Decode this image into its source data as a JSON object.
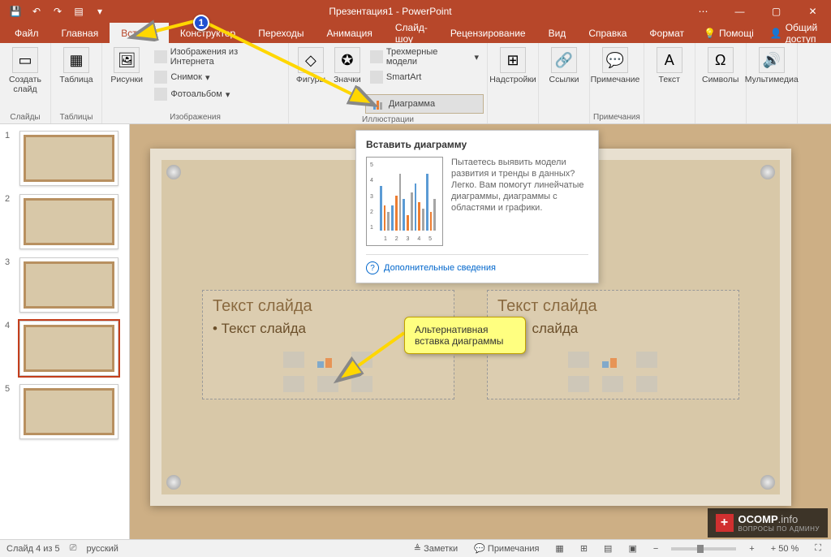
{
  "titlebar": {
    "title": "Презентация1 - PowerPoint",
    "user": "",
    "win": {
      "min": "—",
      "max": "▢",
      "close": "✕"
    }
  },
  "tabs": {
    "items": [
      "Файл",
      "Главная",
      "Вставка",
      "Конструктор",
      "Переходы",
      "Анимация",
      "Слайд-шоу",
      "Рецензирование",
      "Вид",
      "Справка",
      "Формат"
    ],
    "active_index": 2,
    "help": "Помощі",
    "share": "Общий доступ"
  },
  "ribbon": {
    "groups": {
      "slides": {
        "label": "Слайды",
        "new_slide": "Создать слайд"
      },
      "tables": {
        "label": "Таблицы",
        "table": "Таблица"
      },
      "images": {
        "label": "Изображения",
        "pictures": "Рисунки",
        "online": "Изображения из Интернета",
        "screenshot": "Снимок",
        "album": "Фотоальбом"
      },
      "illustrations": {
        "label": "Иллюстрации",
        "shapes": "Фигуры",
        "icons": "Значки",
        "models": "Трехмерные модели",
        "smartart": "SmartArt",
        "chart": "Диаграмма"
      },
      "addins": {
        "label": "",
        "btn": "Надстройки"
      },
      "links": {
        "label": "",
        "btn": "Ссылки"
      },
      "comments": {
        "label": "Примечания",
        "btn": "Примечание"
      },
      "text": {
        "label": "",
        "btn": "Текст"
      },
      "symbols": {
        "label": "",
        "btn": "Символы"
      },
      "media": {
        "label": "",
        "btn": "Мультимедиа"
      }
    }
  },
  "tooltip": {
    "title": "Вставить диаграмму",
    "body": "Пытаетесь выявить модели развития и тренды в данных? Легко. Вам помогут линейчатые диаграммы, диаграммы с областями и графики.",
    "link": "Дополнительные сведения",
    "chart_y": [
      "5",
      "4",
      "3",
      "2",
      "1"
    ],
    "chart_x": [
      "1",
      "2",
      "3",
      "4",
      "5"
    ]
  },
  "slide": {
    "placeholder_title": "Текст слайда",
    "placeholder_bullet": "• Текст слайда"
  },
  "annotations": {
    "badge1": "1",
    "alt_insert": "Альтернативная вставка диаграммы"
  },
  "statusbar": {
    "slide_counter": "Слайд 4 из 5",
    "lang": "русский",
    "notes": "Заметки",
    "comments": "Примечания",
    "zoom": "+ 50 %"
  },
  "thumbs": {
    "count": 5,
    "selected": 4,
    "titles": [
      "",
      "",
      "",
      "",
      ""
    ]
  },
  "watermark": {
    "main": "OCOMP",
    "suffix": ".info",
    "sub": "ВОПРОСЫ ПО АДМИНУ"
  }
}
